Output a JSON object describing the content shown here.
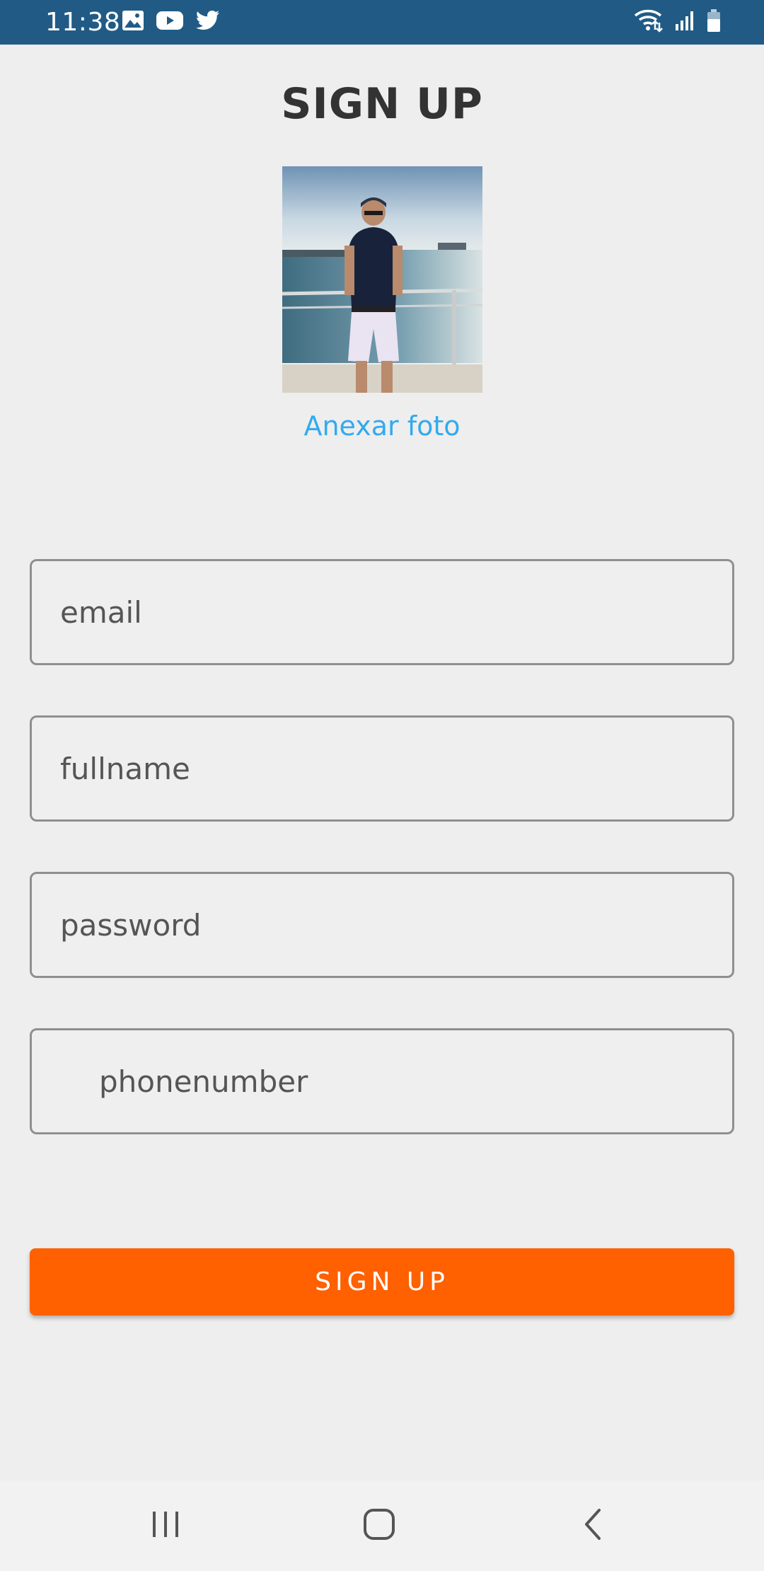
{
  "status_bar": {
    "time": "11:38",
    "left_icons": [
      "image-icon",
      "youtube-icon",
      "twitter-icon"
    ],
    "right_icons": [
      "wifi-icon",
      "signal-icon",
      "battery-icon"
    ],
    "background": "#215b85"
  },
  "page": {
    "title": "SIGN UP",
    "attach_photo_label": "Anexar foto"
  },
  "form": {
    "email_placeholder": "email",
    "fullname_placeholder": "fullname",
    "password_placeholder": "password",
    "phone_placeholder": "phonenumber",
    "submit_label": "SIGN UP"
  },
  "colors": {
    "accent": "#ff6000",
    "link": "#33aaee",
    "background": "#eeeeee"
  },
  "nav_bar": {
    "buttons": [
      "recents-icon",
      "home-icon",
      "back-icon"
    ]
  }
}
